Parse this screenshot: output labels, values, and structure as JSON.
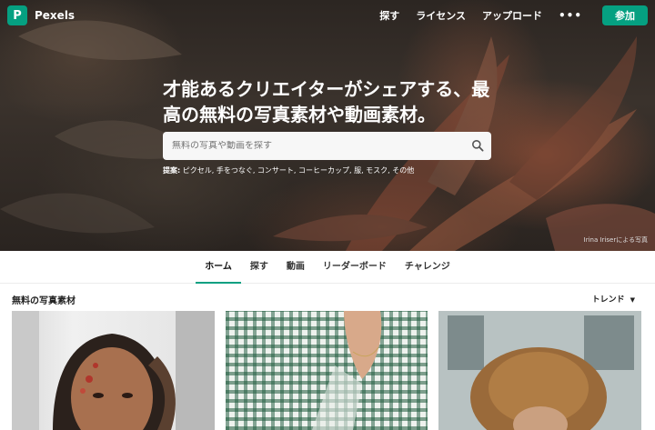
{
  "brand": {
    "name": "Pexels",
    "logo_letter": "P",
    "accent": "#05a081"
  },
  "nav": {
    "links": [
      "探す",
      "ライセンス",
      "アップロード"
    ],
    "more": "•••",
    "join_label": "参加"
  },
  "hero": {
    "headline_line1": "才能あるクリエイターがシェアする、最",
    "headline_line2": "高の無料の写真素材や動画素材。",
    "search_placeholder": "無料の写真や動画を探す",
    "suggest_label": "提案:",
    "suggest_text": " ピクセル, 手をつなぐ, コンサート, コーヒーカップ, 服, モスク, その他",
    "credit": "Irina Iriserによる写真"
  },
  "tabs": [
    "ホーム",
    "探す",
    "動画",
    "リーダーボード",
    "チャレンジ"
  ],
  "section": {
    "title": "無料の写真素材",
    "sort_label": "トレンド"
  }
}
